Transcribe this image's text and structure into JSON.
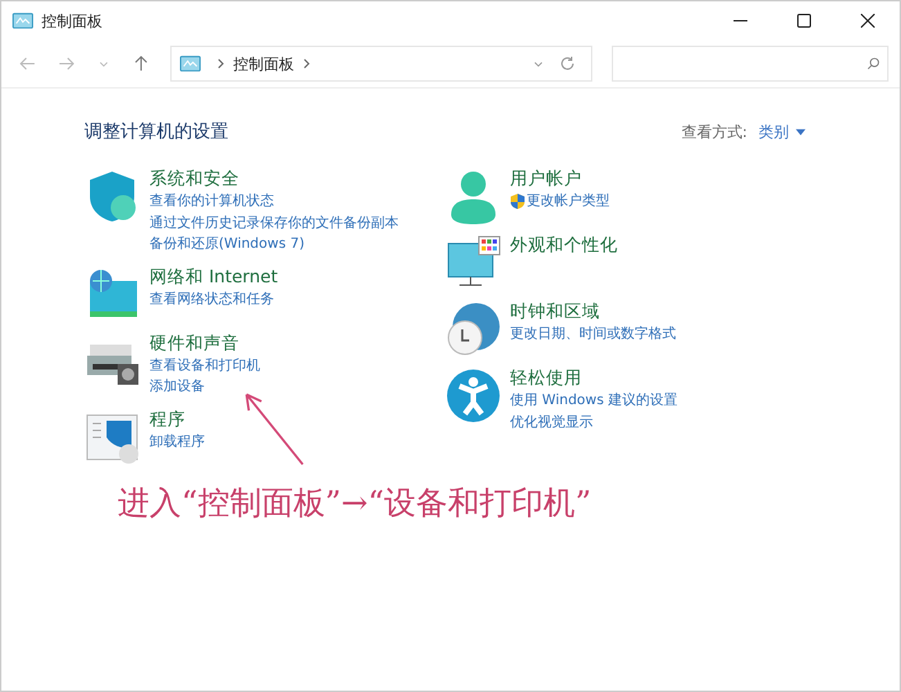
{
  "window": {
    "title": "控制面板"
  },
  "address": {
    "crumbs": [
      "控制面板"
    ]
  },
  "heading": "调整计算机的设置",
  "view_by": {
    "label": "查看方式:",
    "value": "类别"
  },
  "columns": [
    [
      {
        "kind": "shield",
        "title": "系统和安全",
        "links": [
          {
            "text": "查看你的计算机状态",
            "shield": false
          },
          {
            "text": "通过文件历史记录保存你的文件备份副本",
            "shield": false
          },
          {
            "text": "备份和还原(Windows 7)",
            "shield": false
          }
        ]
      },
      {
        "kind": "network",
        "title": "网络和 Internet",
        "links": [
          {
            "text": "查看网络状态和任务",
            "shield": false
          }
        ]
      },
      {
        "kind": "printer",
        "title": "硬件和声音",
        "links": [
          {
            "text": "查看设备和打印机",
            "shield": false
          },
          {
            "text": "添加设备",
            "shield": false
          }
        ]
      },
      {
        "kind": "programs",
        "title": "程序",
        "links": [
          {
            "text": "卸载程序",
            "shield": false
          }
        ]
      }
    ],
    [
      {
        "kind": "user",
        "title": "用户帐户",
        "links": [
          {
            "text": "更改帐户类型",
            "shield": true
          }
        ]
      },
      {
        "kind": "monitor",
        "title": "外观和个性化"
      },
      {
        "kind": "clock",
        "title": "时钟和区域",
        "links": [
          {
            "text": "更改日期、时间或数字格式",
            "shield": false
          }
        ]
      },
      {
        "kind": "access",
        "title": "轻松使用",
        "links": [
          {
            "text": "使用 Windows 建议的设置",
            "shield": false
          },
          {
            "text": "优化视觉显示",
            "shield": false
          }
        ]
      }
    ]
  ],
  "annotation": {
    "text": "进入“控制面板”→“设备和打印机”"
  }
}
